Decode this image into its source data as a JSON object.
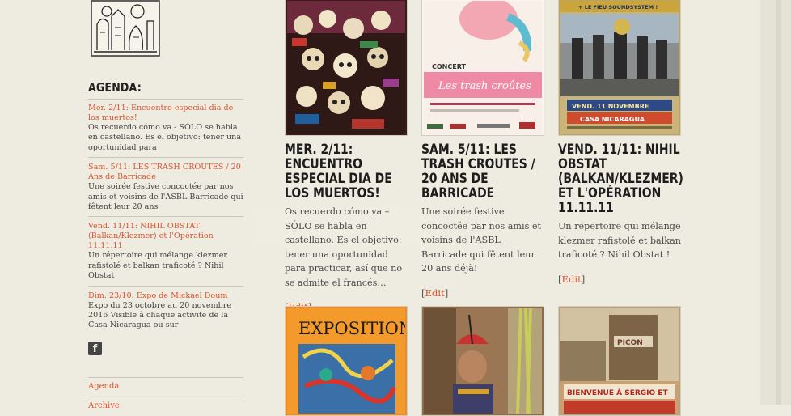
{
  "sidebar": {
    "agenda_heading": "AGENDA:",
    "items": [
      {
        "link": "Mer. 2/11: Encuentro especial dia de los muertos!",
        "desc": "Os recuerdo cómo va - SÓLO se habla en castellano. Es el objetivo: tener una oportunidad para"
      },
      {
        "link": "Sam. 5/11: LES TRASH CROUTES / 20 Ans de Barricade",
        "desc": "Une soirée festive concoctée par nos amis et voisins de l'ASBL Barricade qui fêtent leur 20 ans"
      },
      {
        "link": "Vend. 11/11: NIHIL OBSTAT (Balkan/Klezmer) et l'Opération 11.11.11",
        "desc": "Un répertoire qui mélange klezmer rafistolé et balkan traficoté ? Nihil Obstat"
      },
      {
        "link": "Dim. 23/10: Expo de Mickael Doum",
        "desc": "Expo du 23 octobre au 20 novembre 2016 Visible à chaque activité de la Casa Nicaragua ou sur"
      }
    ],
    "facebook_glyph": "f",
    "footer_links": [
      "Agenda",
      "Archive"
    ]
  },
  "posts": [
    {
      "title": "MER. 2/11: ENCUENTRO ESPECIAL DIA DE LOS MUERTOS!",
      "excerpt": "Os recuerdo cómo va – SÓLO se habla en castellano. Es el objetivo: tener una oportunidad para practicar, así que no se admite el francés…",
      "edit_open": "[",
      "edit_label": "Edit",
      "edit_close": "]"
    },
    {
      "title": "SAM. 5/11: LES TRASH CROUTES / 20 ANS DE BARRICADE",
      "excerpt": "Une soirée festive concoctée par nos amis et voisins de l'ASBL Barricade qui fêtent leur 20 ans déjà!",
      "edit_open": "[",
      "edit_label": "Edit",
      "edit_close": "]",
      "poster_title": "Les trash croûtes",
      "poster_kicker": "CONCERT"
    },
    {
      "title": "VEND. 11/11: NIHIL OBSTAT (BALKAN/KLEZMER) ET L'OPÉRATION 11.11.11",
      "excerpt": "Un répertoire qui mélange klezmer rafistolé et balkan traficoté ? Nihil Obstat !",
      "edit_open": "[",
      "edit_label": "Edit",
      "edit_close": "]",
      "poster_top": "+ LE FIEU SOUNDSYSTEM !",
      "poster_date": "VEND. 11 NOVEMBRE",
      "poster_place": "CASA NICARAGUA"
    },
    {
      "poster_title": "EXPOSITION"
    },
    {},
    {
      "poster_banner": "BIENVENUE À SERGIO ET",
      "poster_sign": "PICON"
    }
  ],
  "colors": {
    "accent": "#d9552f",
    "background": "#eeebe0",
    "text": "#3a3a3a",
    "title": "#1d1d1d"
  }
}
